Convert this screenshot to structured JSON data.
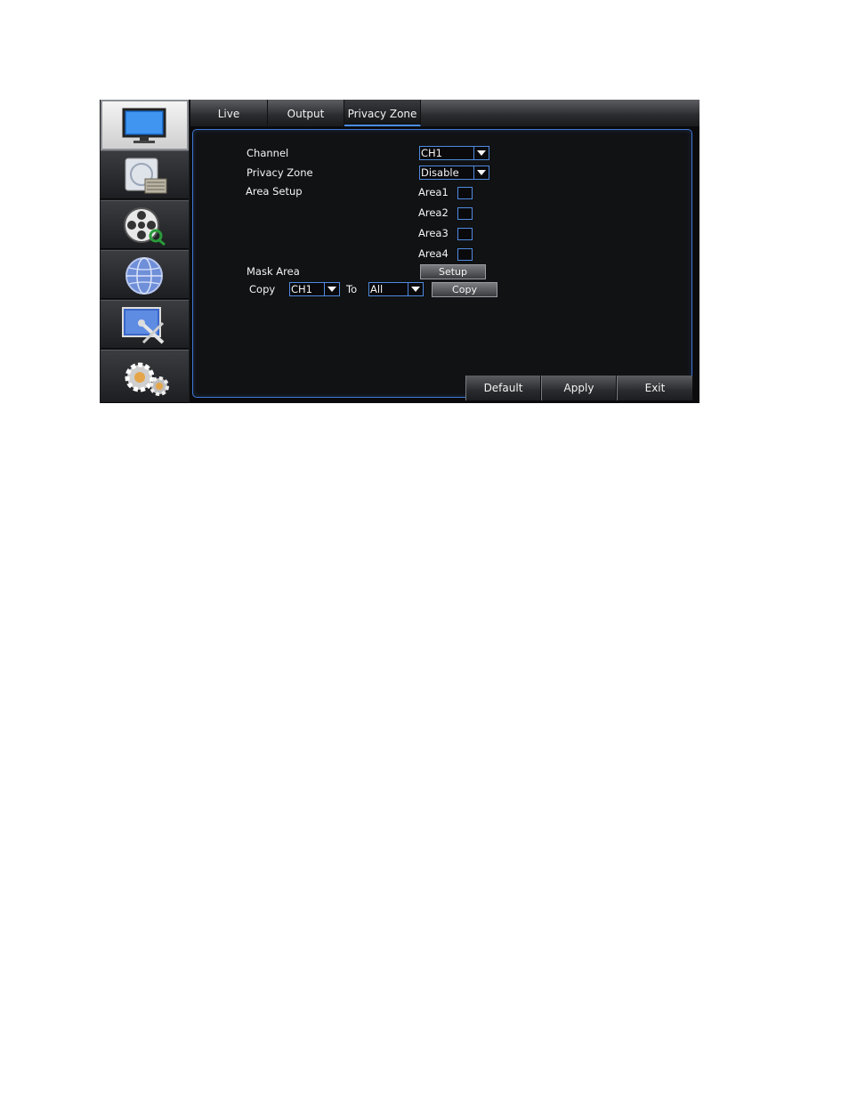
{
  "tabs": [
    {
      "label": "Live"
    },
    {
      "label": "Output"
    },
    {
      "label": "Privacy Zone"
    }
  ],
  "active_tab": "Privacy Zone",
  "sidebar": {
    "items": [
      {
        "icon": "monitor-icon"
      },
      {
        "icon": "record-icon"
      },
      {
        "icon": "film-reel-search-icon"
      },
      {
        "icon": "network-globe-icon"
      },
      {
        "icon": "system-tools-icon"
      },
      {
        "icon": "gears-icon"
      }
    ]
  },
  "form": {
    "channel_label": "Channel",
    "channel_value": "CH1",
    "privacy_zone_label": "Privacy Zone",
    "privacy_zone_value": "Disable",
    "area_setup_label": "Area Setup",
    "areas": [
      "Area1",
      "Area2",
      "Area3",
      "Area4"
    ],
    "mask_area_label": "Mask Area",
    "setup_button": "Setup",
    "copy_label": "Copy",
    "copy_from": "CH1",
    "to_label": "To",
    "copy_to": "All",
    "copy_button": "Copy"
  },
  "footer": {
    "default_label": "Default",
    "apply_label": "Apply",
    "exit_label": "Exit"
  },
  "colors": {
    "accent": "#4f8be0",
    "background": "#0b0b0d",
    "text": "#f4f4f4"
  }
}
